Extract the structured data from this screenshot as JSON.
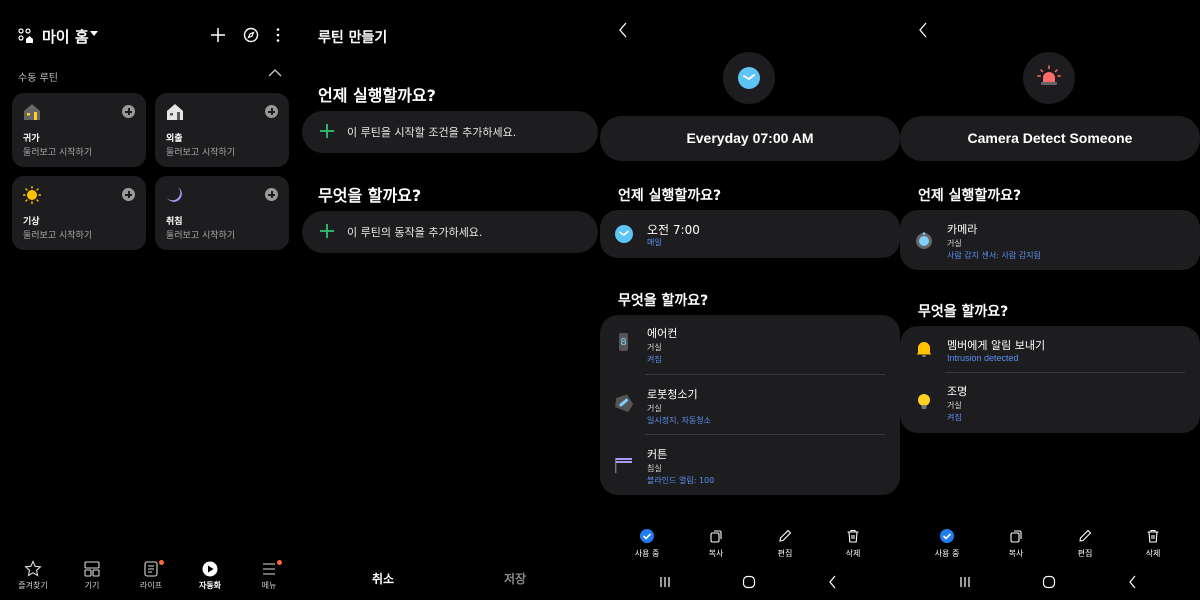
{
  "panel1": {
    "title": "마이 홈",
    "section_label": "수동 루틴",
    "cards": [
      {
        "icon": "home-return-icon",
        "name": "귀가",
        "sub": "둘러보고 시작하기"
      },
      {
        "icon": "home-leave-icon",
        "name": "외출",
        "sub": "둘러보고 시작하기"
      },
      {
        "icon": "sun-icon",
        "name": "기상",
        "sub": "둘러보고 시작하기"
      },
      {
        "icon": "moon-icon",
        "name": "취침",
        "sub": "둘러보고 시작하기"
      }
    ],
    "bottom_nav": [
      {
        "label": "즐겨찾기",
        "icon": "star-icon",
        "active": false,
        "badge": false
      },
      {
        "label": "기기",
        "icon": "devices-icon",
        "active": false,
        "badge": false
      },
      {
        "label": "라이프",
        "icon": "life-icon",
        "active": false,
        "badge": true
      },
      {
        "label": "자동화",
        "icon": "automation-icon",
        "active": true,
        "badge": false
      },
      {
        "label": "메뉴",
        "icon": "menu-icon",
        "active": false,
        "badge": true
      }
    ]
  },
  "panel2": {
    "title": "루틴 만들기",
    "when_heading": "언제 실행할까요?",
    "when_add": "이 루틴을 시작할 조건을 추가하세요.",
    "what_heading": "무엇을 할까요?",
    "what_add": "이 루틴의 동작을 추가하세요.",
    "cancel": "취소",
    "save": "저장"
  },
  "panel3": {
    "routine_name": "Everyday 07:00 AM",
    "when_heading": "언제 실행할까요?",
    "condition": {
      "title": "오전 7:00",
      "detail": "매일"
    },
    "what_heading": "무엇을 할까요?",
    "actions": [
      {
        "icon": "air-conditioner-icon",
        "title": "에어컨",
        "room": "거실",
        "detail": "켜짐"
      },
      {
        "icon": "robot-vacuum-icon",
        "title": "로봇청소기",
        "room": "거실",
        "detail": "일시정지, 자동청소"
      },
      {
        "icon": "curtain-icon",
        "title": "커튼",
        "room": "침실",
        "detail": "블라인드 열림: 100"
      }
    ]
  },
  "panel4": {
    "routine_name": "Camera Detect Someone",
    "when_heading": "언제 실행할까요?",
    "condition": {
      "title": "카메라",
      "room": "거실",
      "detail": "사람 감지 센서: 사람 감지됨"
    },
    "what_heading": "무엇을 할까요?",
    "actions": [
      {
        "icon": "bell-icon",
        "title": "멤버에게 알림 보내기",
        "detail": "Intrusion detected"
      },
      {
        "icon": "light-bulb-icon",
        "title": "조명",
        "room": "거실",
        "detail": "켜짐"
      }
    ]
  },
  "routine_actions": {
    "active": "사용 중",
    "copy": "복사",
    "edit": "편집",
    "delete": "삭제"
  },
  "colors": {
    "background": "#000000",
    "card": "#1d1d1f",
    "accent_blue": "#5c8ff0",
    "active_check": "#1f7cf2",
    "add_green": "#2fb36b",
    "badge": "#ff6a3d"
  }
}
